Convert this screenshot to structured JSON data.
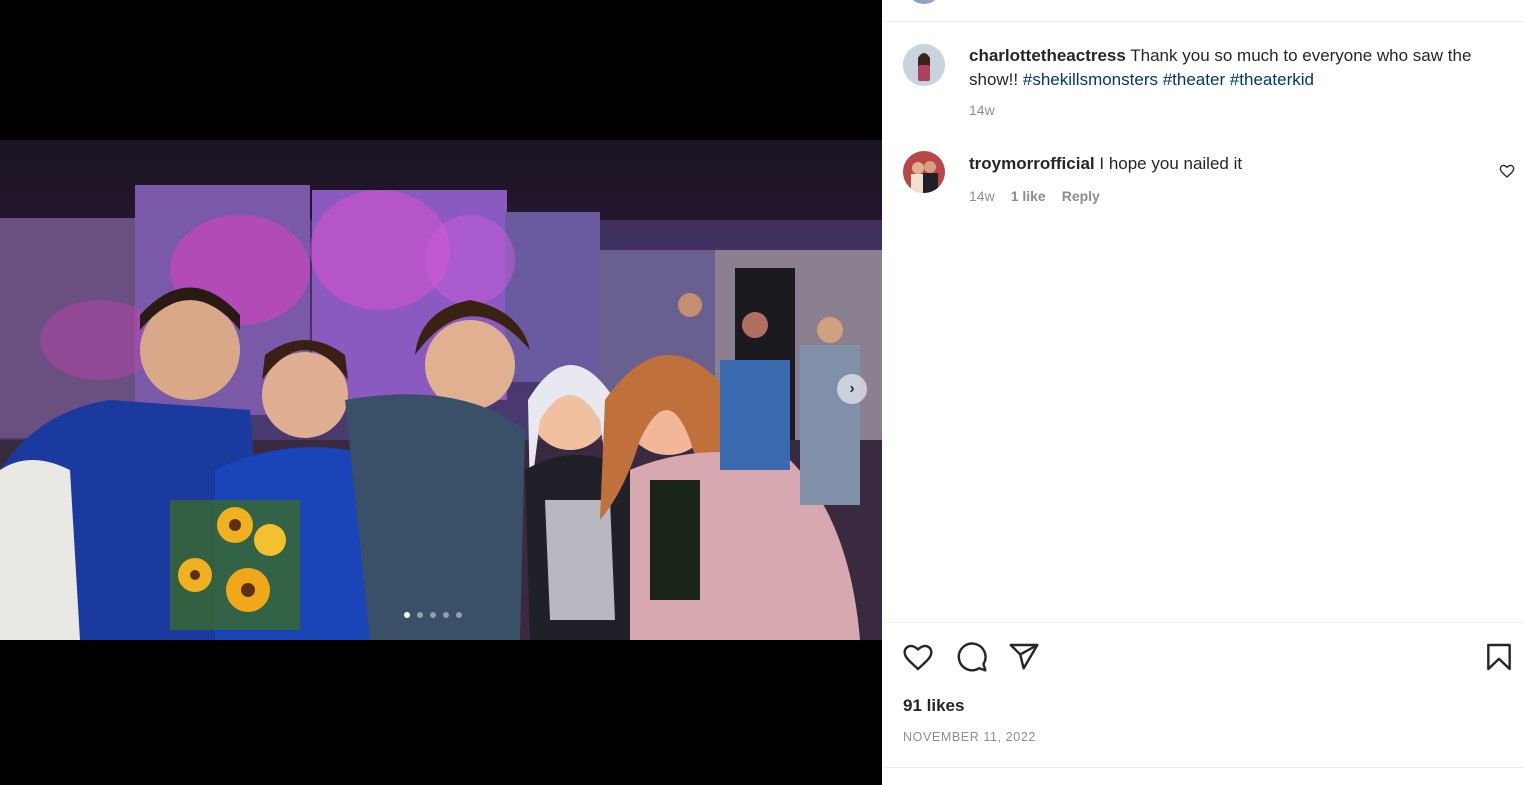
{
  "post": {
    "author": "charlottetheactress",
    "caption_text": "Thank you so much to everyone who saw the show!!",
    "hashtags": [
      "#shekillsmonsters",
      "#theater",
      "#theaterkid"
    ],
    "age": "14w"
  },
  "comments": [
    {
      "username": "troymorrofficial",
      "text": "I hope you nailed it",
      "age": "14w",
      "likes": "1 like",
      "reply_label": "Reply"
    }
  ],
  "footer": {
    "likes": "91 likes",
    "date": "NOVEMBER 11, 2022"
  },
  "carousel": {
    "slide_count": 5,
    "active_index": 0
  },
  "icons": {
    "like": "heart-icon",
    "comment": "comment-icon",
    "share": "paper-plane-icon",
    "save": "bookmark-icon",
    "next": "chevron-right-icon"
  }
}
